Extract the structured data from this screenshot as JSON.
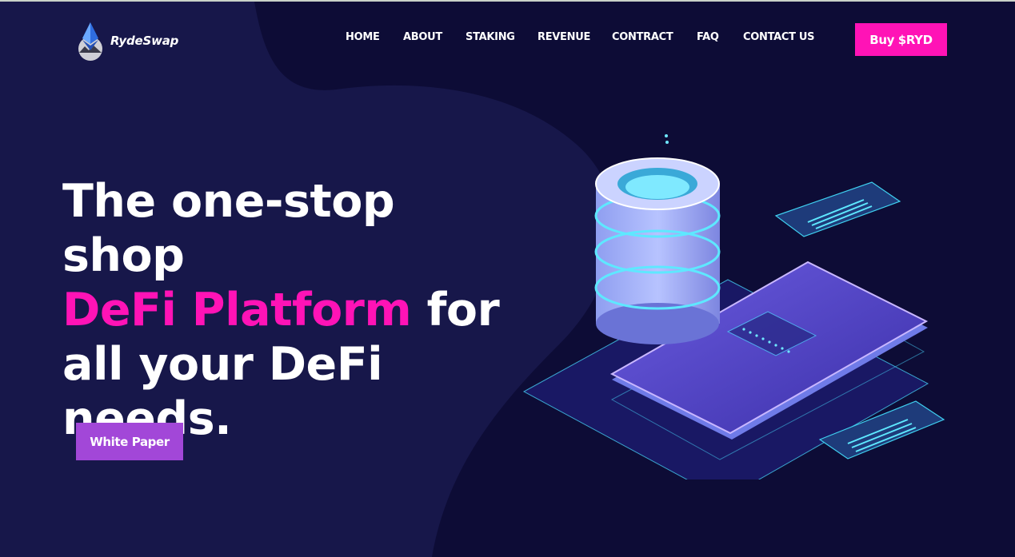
{
  "brand": {
    "name": "RydeSwap",
    "logo_icon": "ethereum-diamond-icon"
  },
  "nav": {
    "items": [
      {
        "label": "HOME"
      },
      {
        "label": "ABOUT"
      },
      {
        "label": "STAKING"
      },
      {
        "label": "REVENUE"
      },
      {
        "label": "CONTRACT"
      },
      {
        "label": "FAQ"
      },
      {
        "label": "CONTACT US"
      }
    ],
    "cta_label": "Buy $RYD"
  },
  "hero": {
    "line1": "The one-stop shop",
    "accent": "DeFi Platform",
    "line2_rest": " for",
    "line3": "all your DeFi",
    "line4": "needs.",
    "button_label": "White Paper"
  },
  "colors": {
    "background": "#0d0c36",
    "accent_pink": "#ff13b6",
    "button_purple": "#a247d8",
    "text": "#ffffff"
  }
}
